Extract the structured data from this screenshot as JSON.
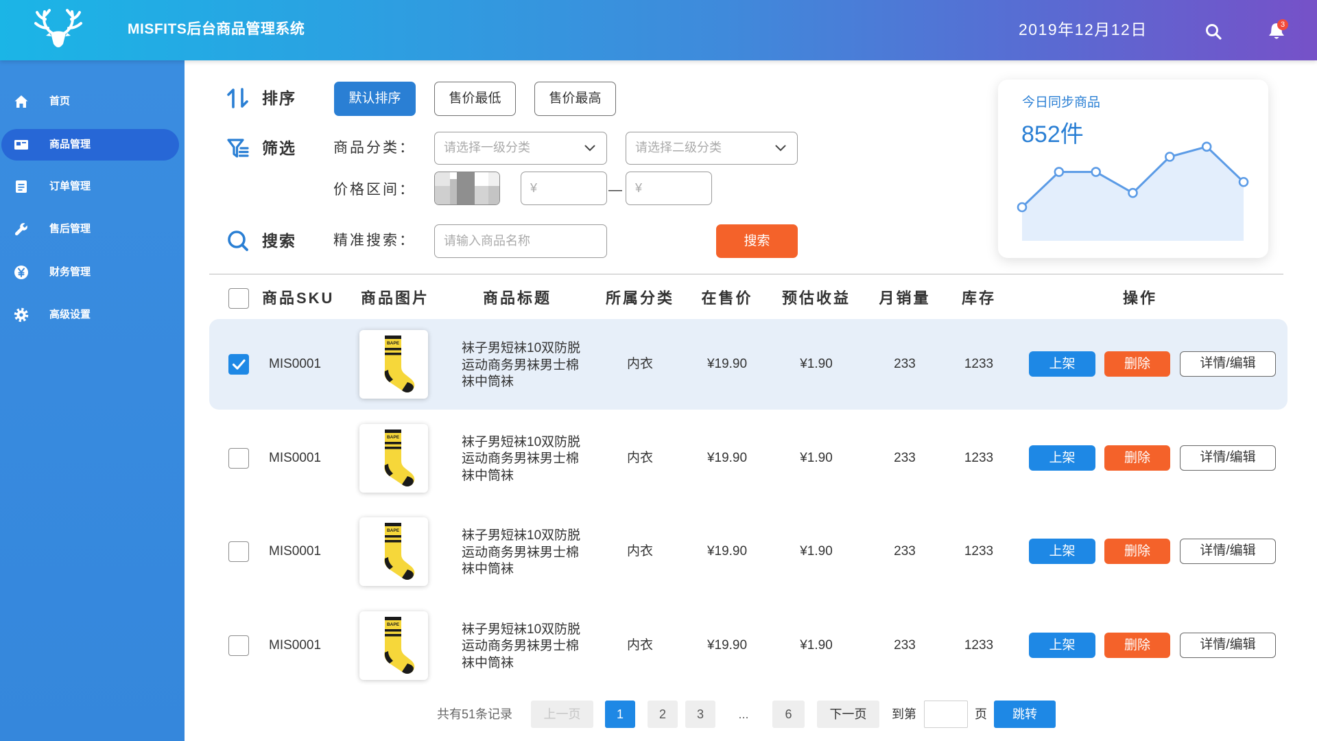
{
  "header": {
    "title": "MISFITS后台商品管理系统",
    "date": "2019年12月12日",
    "notification_count": "3",
    "icons": [
      "deer-antler-logo",
      "search-icon",
      "bell-icon"
    ]
  },
  "sidebar": {
    "items": [
      {
        "label": "首页",
        "icon": "home-icon",
        "active": false
      },
      {
        "label": "商品管理",
        "icon": "product-icon",
        "active": true
      },
      {
        "label": "订单管理",
        "icon": "order-icon",
        "active": false
      },
      {
        "label": "售后管理",
        "icon": "wrench-icon",
        "active": false
      },
      {
        "label": "财务管理",
        "icon": "yen-icon",
        "active": false
      },
      {
        "label": "高级设置",
        "icon": "gear-icon",
        "active": false
      }
    ]
  },
  "sort": {
    "label": "排序",
    "icon": "sort-arrows-icon",
    "options": [
      "默认排序",
      "售价最低",
      "售价最高"
    ],
    "selected_index": 0
  },
  "filter": {
    "label": "筛选",
    "icon": "filter-icon",
    "category_label": "商品分类：",
    "category1_placeholder": "请选择一级分类",
    "category2_placeholder": "请选择二级分类",
    "price_label": "价格区间：",
    "price_min_placeholder": "¥",
    "price_max_placeholder": "¥",
    "range_separator": "—"
  },
  "search": {
    "label": "搜索",
    "icon": "magnifier-icon",
    "field_label": "精准搜索：",
    "placeholder": "请输入商品名称",
    "button": "搜索"
  },
  "stats_card": {
    "title": "今日同步商品",
    "value": "852件"
  },
  "chart_data": {
    "type": "area",
    "values": [
      40,
      82,
      82,
      57,
      100,
      112,
      70
    ],
    "ylim": [
      0,
      120
    ],
    "grid": false
  },
  "table": {
    "headers": [
      "商品SKU",
      "商品图片",
      "商品标题",
      "所属分类",
      "在售价",
      "预估收益",
      "月销量",
      "库存",
      "操作"
    ],
    "product_image_text": "BAPE",
    "actions": {
      "shelve": "上架",
      "delete": "删除",
      "edit": "详情/编辑"
    },
    "rows": [
      {
        "selected": true,
        "sku": "MIS0001",
        "title_lines": [
          "袜子男短袜10双防脱",
          "运动商务男袜男士棉",
          "袜中筒袜"
        ],
        "category": "内衣",
        "price": "¥19.90",
        "profit": "¥1.90",
        "monthly_sales": "233",
        "stock": "1233"
      },
      {
        "selected": false,
        "sku": "MIS0001",
        "title_lines": [
          "袜子男短袜10双防脱",
          "运动商务男袜男士棉",
          "袜中筒袜"
        ],
        "category": "内衣",
        "price": "¥19.90",
        "profit": "¥1.90",
        "monthly_sales": "233",
        "stock": "1233"
      },
      {
        "selected": false,
        "sku": "MIS0001",
        "title_lines": [
          "袜子男短袜10双防脱",
          "运动商务男袜男士棉",
          "袜中筒袜"
        ],
        "category": "内衣",
        "price": "¥19.90",
        "profit": "¥1.90",
        "monthly_sales": "233",
        "stock": "1233"
      },
      {
        "selected": false,
        "sku": "MIS0001",
        "title_lines": [
          "袜子男短袜10双防脱",
          "运动商务男袜男士棉",
          "袜中筒袜"
        ],
        "category": "内衣",
        "price": "¥19.90",
        "profit": "¥1.90",
        "monthly_sales": "233",
        "stock": "1233"
      }
    ]
  },
  "pagination": {
    "total": "共有51条记录",
    "prev": "上一页",
    "pages": [
      "1",
      "2",
      "3",
      "...",
      "6"
    ],
    "current_index": 0,
    "next": "下一页",
    "goto_label": "到第",
    "page_suffix": "页",
    "jump": "跳转"
  },
  "colors": {
    "primary": "#1e88e5",
    "accent_orange": "#f4622a",
    "sidebar": "#3789dd",
    "sidebar_active": "#2767d6",
    "header_gradient": [
      "#1bb5e6",
      "#7651c8"
    ],
    "selected_row": "#e7eff9"
  }
}
